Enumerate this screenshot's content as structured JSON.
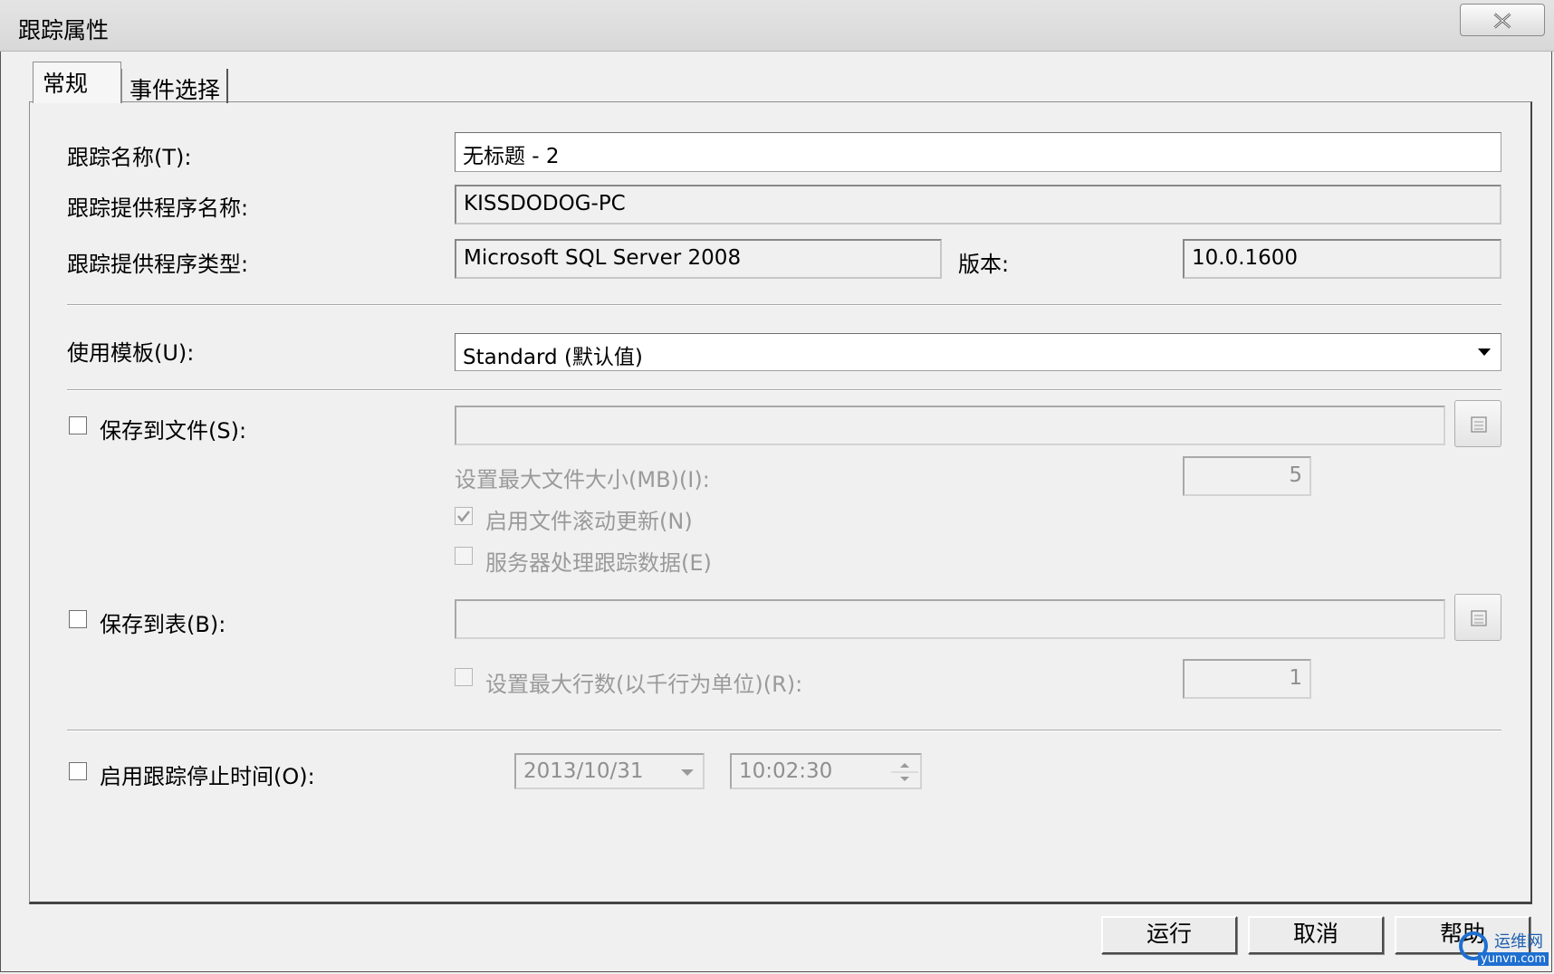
{
  "window": {
    "title": "跟踪属性"
  },
  "tabs": [
    {
      "label": "常规"
    },
    {
      "label": "事件选择"
    }
  ],
  "general": {
    "trace_name": {
      "label": "跟踪名称(T):",
      "value": "无标题 - 2"
    },
    "provider_name": {
      "label": "跟踪提供程序名称:",
      "value": "KISSDODOG-PC"
    },
    "provider_type": {
      "label": "跟踪提供程序类型:",
      "value": "Microsoft SQL Server 2008"
    },
    "version": {
      "label": "版本:",
      "value": "10.0.1600"
    },
    "template": {
      "label": "使用模板(U):",
      "value": "Standard (默认值)"
    },
    "save_to_file": {
      "label": "保存到文件(S):",
      "checked": false,
      "path": "",
      "max_size_label": "设置最大文件大小(MB)(I):",
      "max_size": "5",
      "rollover_label": "启用文件滚动更新(N)",
      "rollover_checked": true,
      "server_process_label": "服务器处理跟踪数据(E)",
      "server_process_checked": false
    },
    "save_to_table": {
      "label": "保存到表(B):",
      "checked": false,
      "table": "",
      "max_rows_label": "设置最大行数(以千行为单位)(R):",
      "max_rows": "1",
      "max_rows_checked": false
    },
    "stop_time": {
      "label": "启用跟踪停止时间(O):",
      "checked": false,
      "date": "2013/10/31",
      "time": "10:02:30"
    }
  },
  "buttons": {
    "run": "运行",
    "cancel": "取消",
    "help": "帮助"
  },
  "watermark": {
    "text_cn": "运维网",
    "text_url": "yunvn.com"
  }
}
